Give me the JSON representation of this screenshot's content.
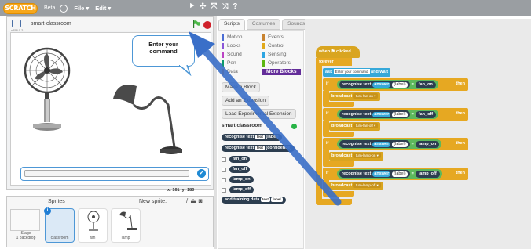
{
  "menubar": {
    "logo": "SCRATCH",
    "beta": "Beta",
    "file": "File ▾",
    "edit": "Edit ▾",
    "tools": [
      "⯈",
      "✣",
      "⤧",
      "⤨",
      "?"
    ]
  },
  "stage": {
    "title": "smart-classroom",
    "version": "v458.0.2",
    "speech": {
      "line1": "Enter your",
      "line2": "command"
    },
    "coords": {
      "x_label": "x:",
      "x": "161",
      "y_label": "y:",
      "y": "180"
    }
  },
  "sprites": {
    "label": "Sprites",
    "new_sprite": "New sprite:",
    "stage_thumb": {
      "name": "Stage",
      "backdrops": "1 backdrop"
    },
    "items": [
      {
        "name": "classroom"
      },
      {
        "name": "fan"
      },
      {
        "name": "lamp"
      }
    ]
  },
  "tabs": [
    "Scripts",
    "Costumes",
    "Sounds"
  ],
  "categories": [
    {
      "label": "Motion",
      "color": "#4a6cd4"
    },
    {
      "label": "Events",
      "color": "#c88330"
    },
    {
      "label": "Looks",
      "color": "#8a55d7"
    },
    {
      "label": "Control",
      "color": "#e1a91a"
    },
    {
      "label": "Sound",
      "color": "#bb42c3"
    },
    {
      "label": "Sensing",
      "color": "#2ca5e2"
    },
    {
      "label": "Pen",
      "color": "#0e9a6c"
    },
    {
      "label": "Operators",
      "color": "#5cb712"
    },
    {
      "label": "Data",
      "color": "#ee7d16"
    },
    {
      "label": "More Blocks",
      "color": "#632d99"
    }
  ],
  "palette": {
    "make_block": "Make a Block",
    "add_extension": "Add an Extension",
    "load_extension": "Load Experimental Extension",
    "ml_title": "smart classroom",
    "rec1_text": "recognise text",
    "rec1_slot": "text",
    "rec1_tail": "(label)",
    "rec2_text": "recognise text",
    "rec2_slot": "text",
    "rec2_tail": "(confidence)",
    "labels": [
      "fan_on",
      "fan_off",
      "lamp_on",
      "lamp_off"
    ],
    "add_training": "add training data",
    "add_slot1": "text",
    "add_slot2": "label"
  },
  "script": {
    "hat": "when ⚑ clicked",
    "forever": "forever",
    "ask": "ask",
    "ask_prompt": "Enter your command",
    "ask_wait": "and wait",
    "if_word": "if",
    "then_word": "then",
    "recognise": "recognise text",
    "answer": "answer",
    "label": "(label)",
    "equals": "=",
    "broadcast": "broadcast",
    "rules": [
      {
        "value": "fan_on",
        "message": "turn-fan-on ▾"
      },
      {
        "value": "fan_off",
        "message": "turn-fan-off ▾"
      },
      {
        "value": "lamp_on",
        "message": "turn-lamp-on ▾"
      },
      {
        "value": "lamp_off",
        "message": "turn-lamp-off ▾"
      }
    ]
  },
  "colors": {
    "accent": "#4d97d6",
    "arrow": "#3a6fc8",
    "control": "#e6a822",
    "ml_block": "#2d3e50"
  }
}
